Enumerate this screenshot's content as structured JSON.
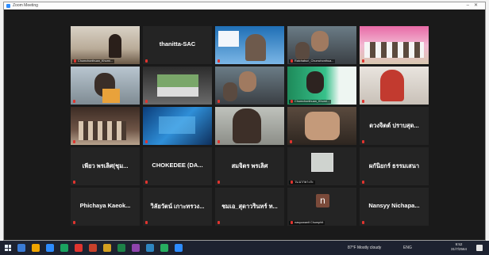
{
  "window": {
    "title": "Zoom Meeting"
  },
  "tiles": [
    {
      "type": "video",
      "label": "Chumchonthuan_Khumi...",
      "scene": "room"
    },
    {
      "type": "name",
      "name": "thanitta-SAC"
    },
    {
      "type": "video",
      "label": "",
      "scene": "presenter"
    },
    {
      "type": "video",
      "label": "Ratchaburi_Chumchonthua...",
      "scene": "kids"
    },
    {
      "type": "video",
      "label": "",
      "scene": "class"
    },
    {
      "type": "video",
      "label": "",
      "scene": "child"
    },
    {
      "type": "video",
      "label": "",
      "scene": "school"
    },
    {
      "type": "video",
      "label": "",
      "scene": "kids"
    },
    {
      "type": "video",
      "label": "Chumchonthuan_Khumi...",
      "scene": "green",
      "active": true
    },
    {
      "type": "video",
      "label": "",
      "scene": "girl"
    },
    {
      "type": "video",
      "label": "",
      "scene": "hall"
    },
    {
      "type": "video",
      "label": "",
      "scene": "screen"
    },
    {
      "type": "video",
      "label": "",
      "scene": "man"
    },
    {
      "type": "video",
      "label": "",
      "scene": "family"
    },
    {
      "type": "name",
      "name": "ดวงจิตต์ ปราบสุด..."
    },
    {
      "type": "name",
      "name": "เพียว พรเลิศ(ชุม..."
    },
    {
      "type": "name",
      "name": "CHOKEDEE  (DA..."
    },
    {
      "type": "name",
      "name": "สมจิตร พรเลิศ"
    },
    {
      "type": "thumb",
      "label": "วน มากพาะสะ"
    },
    {
      "type": "name",
      "name": "ผกันิยกร์ ธรรมเสนา"
    },
    {
      "type": "name",
      "name": "Phichaya  Kaeok..."
    },
    {
      "type": "name",
      "name": "วิลัยวัตน์ เกาะทรวง..."
    },
    {
      "type": "name",
      "name": "ชมเอ_สุดาวรินทร์ ท..."
    },
    {
      "type": "avatar",
      "initial": "n",
      "label": "nasyowanit Chumphit"
    },
    {
      "type": "name",
      "name": "Nansyy  Nichapa..."
    }
  ],
  "taskbar": {
    "weather": "87°F  Mostly cloudy",
    "tray": "ENG",
    "time": "9:52",
    "date": "31/7/2564",
    "apps": [
      "#3a7bd5",
      "#f0a500",
      "#2d8cff",
      "#1aa260",
      "#e0342f",
      "#c8412b",
      "#d4a020",
      "#1d8348",
      "#8e44ad",
      "#2e86c1",
      "#27ae60",
      "#2d8cff"
    ]
  }
}
